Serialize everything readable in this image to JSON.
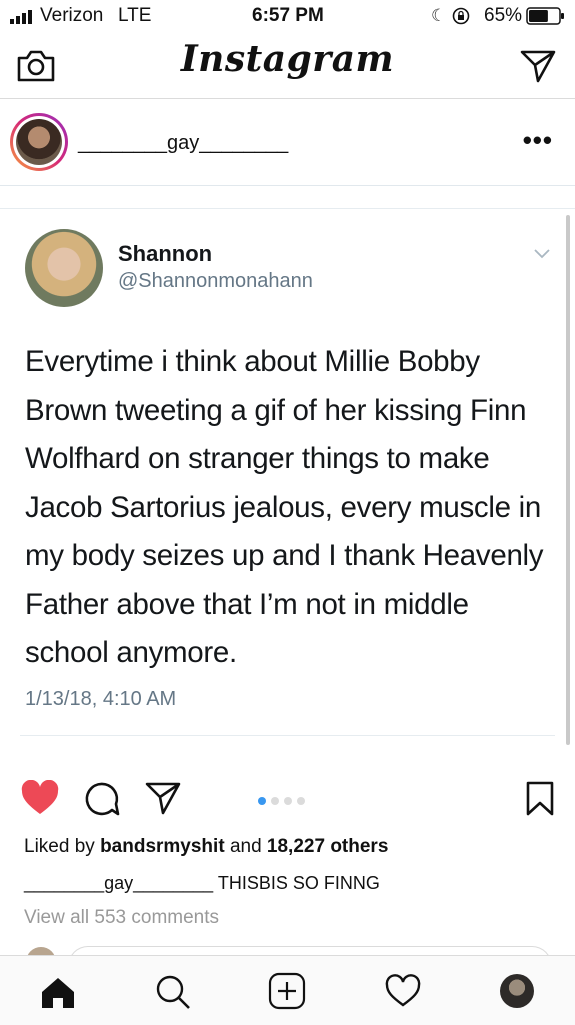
{
  "status_bar": {
    "carrier": "Verizon",
    "network": "LTE",
    "time": "6:57 PM",
    "battery": "65%",
    "battery_level": 0.65
  },
  "header": {
    "title": "Instagram",
    "left_icon": "camera-icon",
    "right_icon": "direct-message-icon"
  },
  "post": {
    "username": "________gay________",
    "more_label": "•••"
  },
  "tweet": {
    "name": "Shannon",
    "handle": "@Shannonmonahann",
    "text": "Everytime i think about Millie Bobby Brown tweeting a gif of her kissing Finn Wolfhard on stranger things to make Jacob Sartorius jealous, every muscle in my body seizes up and I thank Heavenly Father above that I’m not in middle school anymore.",
    "date": "1/13/18, 4:10 AM"
  },
  "actions": {
    "liked": true,
    "carousel_total": 4,
    "carousel_index": 1
  },
  "likes": {
    "prefix": "Liked by",
    "user": "bandsrmyshit",
    "middle": "and",
    "count": "18,227 others"
  },
  "caption": {
    "user": "________gay________",
    "text": "THISBIS SO FINNG"
  },
  "comments_link": "View all 553 comments",
  "colors": {
    "heart": "#ed4956",
    "dot_active": "#3897f0",
    "twitter_gray": "#657786"
  }
}
